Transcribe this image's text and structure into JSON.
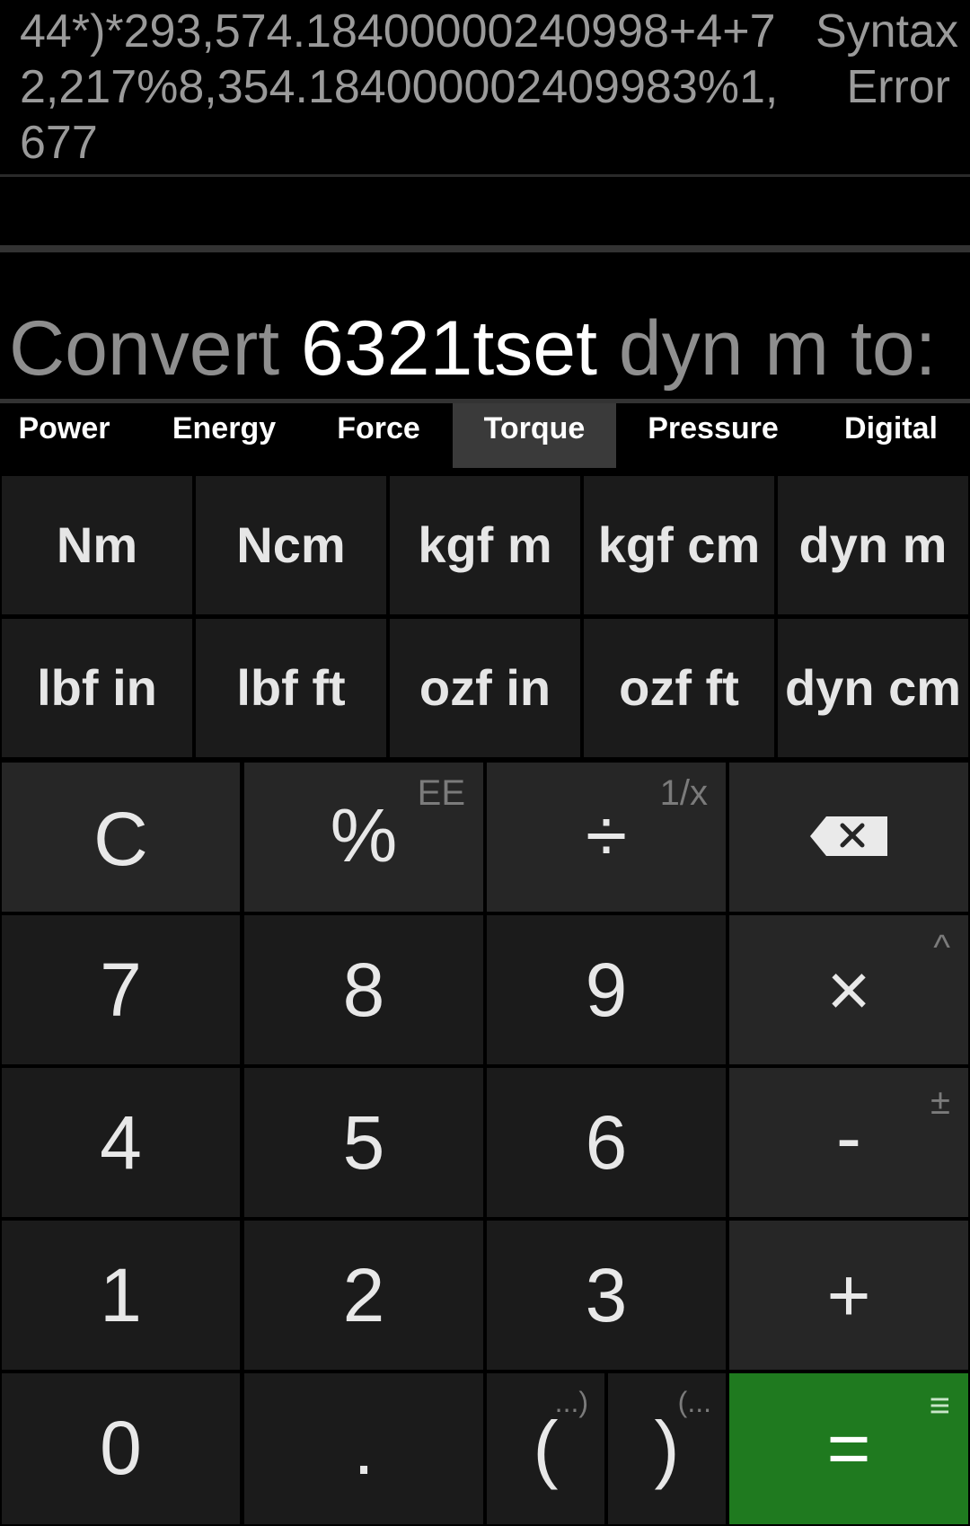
{
  "history": {
    "expression": "44*)*293,574.18400000240998+4+72,217%8,354.184000002409983%1,677",
    "result": "Syntax Error"
  },
  "convert": {
    "prefix": "Convert ",
    "value": "6321tset",
    "suffix": " dyn m to:"
  },
  "tabs": [
    {
      "label": "Power"
    },
    {
      "label": "Energy"
    },
    {
      "label": "Force"
    },
    {
      "label": "Torque",
      "active": true
    },
    {
      "label": "Pressure"
    },
    {
      "label": "Digital"
    }
  ],
  "units": {
    "row1": [
      "Nm",
      "Ncm",
      "kgf m",
      "kgf cm",
      "dyn m"
    ],
    "row2": [
      "lbf in",
      "lbf ft",
      "ozf in",
      "ozf ft",
      "dyn cm"
    ]
  },
  "keys": {
    "clear": "C",
    "percent": "%",
    "percent_alt": "EE",
    "divide": "÷",
    "divide_alt": "1/x",
    "backspace_icon": "backspace-icon",
    "seven": "7",
    "eight": "8",
    "nine": "9",
    "multiply": "×",
    "multiply_alt": "^",
    "four": "4",
    "five": "5",
    "six": "6",
    "minus": "-",
    "minus_alt": "±",
    "one": "1",
    "two": "2",
    "three": "3",
    "plus": "+",
    "zero": "0",
    "dot": ".",
    "open_paren": "(",
    "open_paren_alt": "...)",
    "close_paren": ")",
    "close_paren_alt": "(...",
    "equals": "=",
    "equals_alt": "≡"
  },
  "colors": {
    "equals_bg": "#1f7a1f",
    "background": "#000000"
  }
}
